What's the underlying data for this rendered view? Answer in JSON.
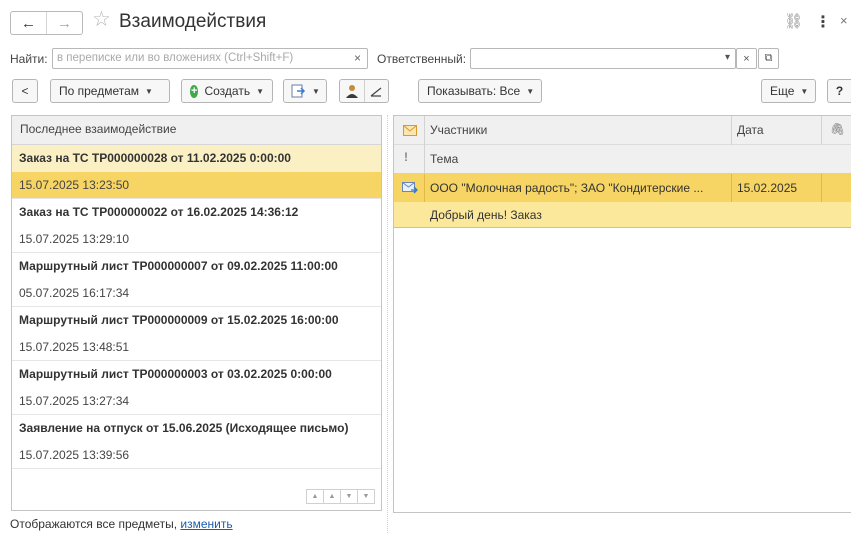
{
  "window": {
    "title": "Взаимодействия",
    "back_glyph": "←",
    "forward_glyph": "→",
    "star_glyph": "☆",
    "link_glyph": "⛓",
    "more_glyph": "⋮",
    "close_glyph": "×"
  },
  "search": {
    "label": "Найти:",
    "placeholder": "в переписке или во вложениях (Ctrl+Shift+F)",
    "clear": "×",
    "responsible_label": "Ответственный:",
    "responsible_value": "",
    "dropdown_glyph": "▾",
    "open_glyph": "⧉"
  },
  "toolbar": {
    "back_glyph": "<",
    "by_subjects": "По предметам",
    "create": "Создать",
    "create_glyph": "+",
    "show_all": "Показывать: Все",
    "more": "Еще",
    "help": "?"
  },
  "left_panel": {
    "header": "Последнее взаимодействие",
    "items": [
      {
        "subject": "Заказ на ТС ТР000000028 от 11.02.2025 0:00:00",
        "date": "15.07.2025 13:23:50"
      },
      {
        "subject": "Заказ на ТС ТР000000022 от 16.02.2025 14:36:12",
        "date": "15.07.2025 13:29:10"
      },
      {
        "subject": "Маршрутный лист ТР000000007 от 09.02.2025 11:00:00",
        "date": "05.07.2025 16:17:34"
      },
      {
        "subject": "Маршрутный лист ТР000000009 от 15.02.2025 16:00:00",
        "date": "15.07.2025 13:48:51"
      },
      {
        "subject": "Маршрутный лист ТР000000003 от 03.02.2025 0:00:00",
        "date": "15.07.2025 13:27:34"
      },
      {
        "subject": "Заявление на отпуск от 15.06.2025 (Исходящее письмо)",
        "date": "15.07.2025 13:39:56"
      }
    ]
  },
  "right_panel": {
    "col_participants": "Участники",
    "col_date": "Дата",
    "col_topic": "Тема",
    "rows": [
      {
        "participants": "ООО \"Молочная радость\"; ЗАО \"Кондитерские ...",
        "date": "15.02.2025",
        "topic": "Добрый день! Заказ"
      }
    ]
  },
  "footer": {
    "text": "Отображаются все предметы,",
    "link": "изменить"
  },
  "colors": {
    "selection": "#f7d564",
    "selection_light": "#fbf0c4",
    "accent_green": "#3fa84b",
    "link": "#1d5da8"
  }
}
